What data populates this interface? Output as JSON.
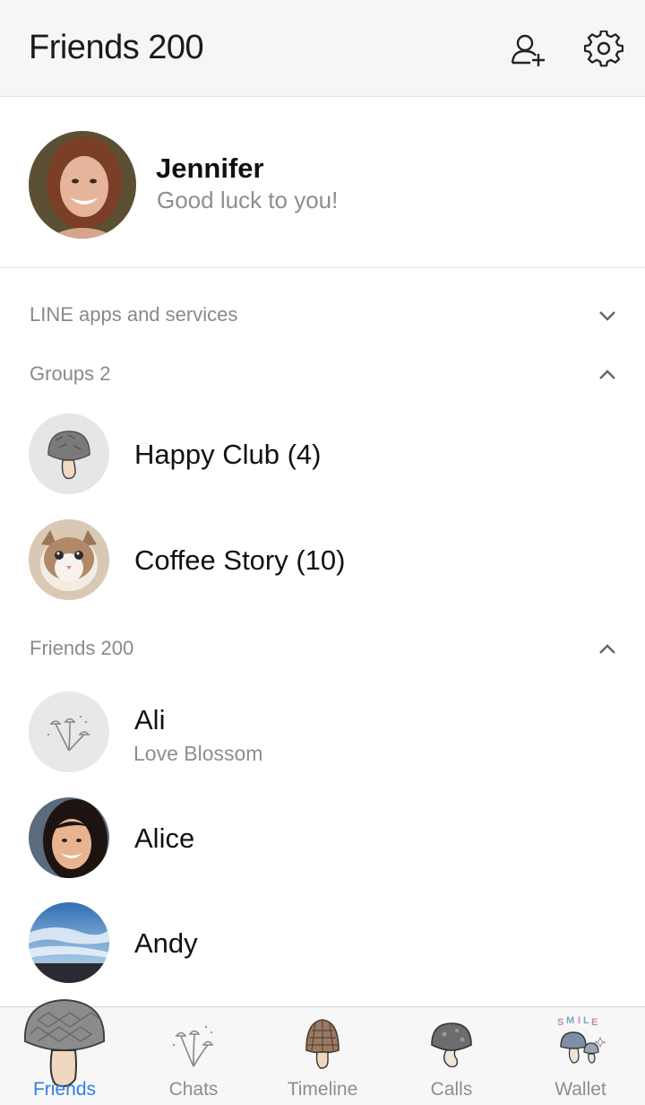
{
  "header": {
    "title": "Friends 200",
    "add_friend_icon": "add-friend-icon",
    "settings_icon": "gear-icon"
  },
  "profile": {
    "name": "Jennifer",
    "status": "Good luck to you!"
  },
  "sections": {
    "services": {
      "label": "LINE apps and services",
      "state": "collapsed"
    },
    "groups": {
      "label": "Groups 2",
      "state": "expanded"
    },
    "friends": {
      "label": "Friends 200",
      "state": "expanded"
    }
  },
  "groups": [
    {
      "name": "Happy Club (4)"
    },
    {
      "name": "Coffee Story (10)"
    }
  ],
  "friends": [
    {
      "name": "Ali",
      "status": "Love Blossom"
    },
    {
      "name": "Alice"
    },
    {
      "name": "Andy"
    }
  ],
  "tabs": [
    {
      "label": "Friends",
      "icon": "mushroom-icon",
      "active": true
    },
    {
      "label": "Chats",
      "icon": "mushroom-sprout-icon"
    },
    {
      "label": "Timeline",
      "icon": "morel-icon"
    },
    {
      "label": "Calls",
      "icon": "mushroom-icon"
    },
    {
      "label": "Wallet",
      "icon": "smile-mushrooms-icon"
    }
  ],
  "colors": {
    "accent": "#2f7ee6",
    "header_bg": "#f6f6f6",
    "muted_text": "#8e8e8e"
  }
}
